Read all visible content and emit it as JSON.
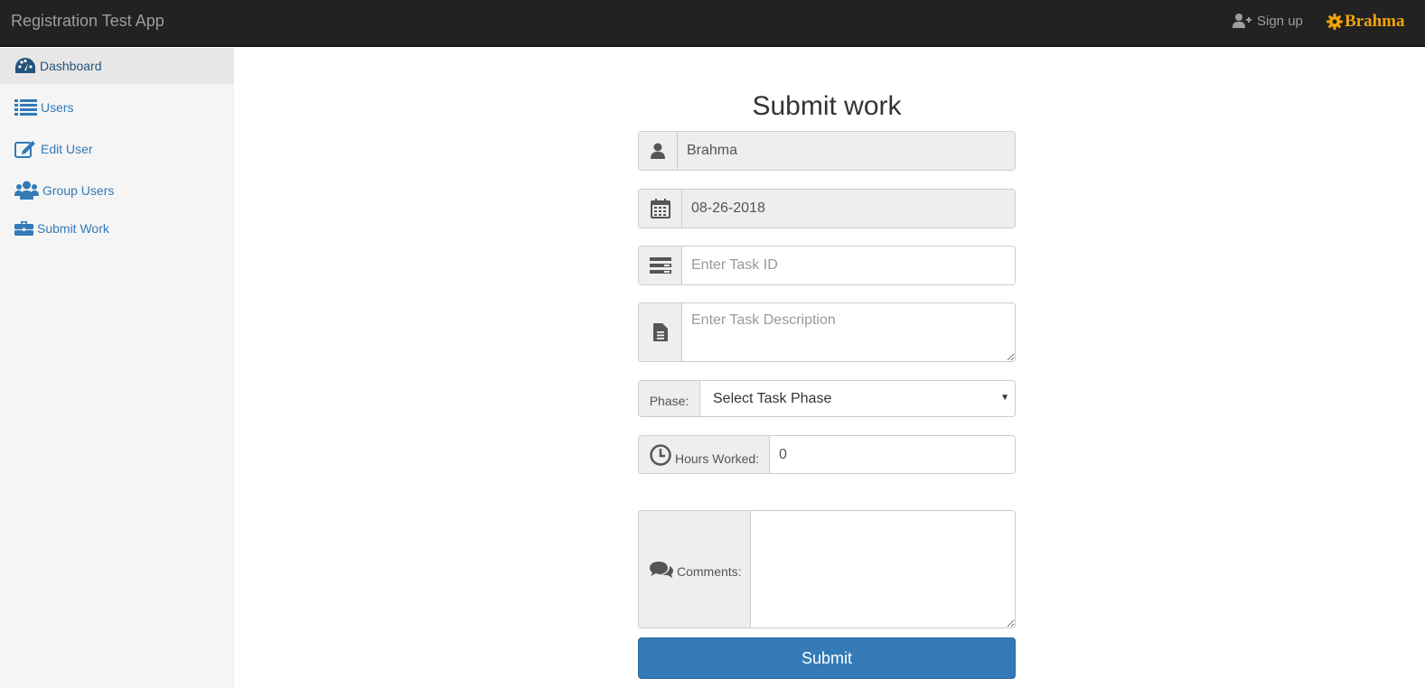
{
  "navbar": {
    "brand": "Registration Test App",
    "signup_label": "Sign up",
    "user_label": "Brahma",
    "accent_color": "#f0a30a"
  },
  "sidebar": {
    "items": [
      {
        "label": "Dashboard",
        "icon": "dashboard-icon",
        "active": true
      },
      {
        "label": "Users",
        "icon": "list-icon"
      },
      {
        "label": "Edit User",
        "icon": "edit-icon"
      },
      {
        "label": "Group Users",
        "icon": "users-icon"
      },
      {
        "label": "Submit Work",
        "icon": "briefcase-icon"
      }
    ]
  },
  "form": {
    "title": "Submit work",
    "username_value": "Brahma",
    "date_value": "08-26-2018",
    "task_id_placeholder": "Enter Task ID",
    "task_desc_placeholder": "Enter Task Description",
    "phase_label": "Phase:",
    "phase_selected": "Select Task Phase",
    "hours_label": "Hours Worked:",
    "hours_value": "0",
    "comments_label": "Comments:",
    "submit_label": "Submit"
  }
}
